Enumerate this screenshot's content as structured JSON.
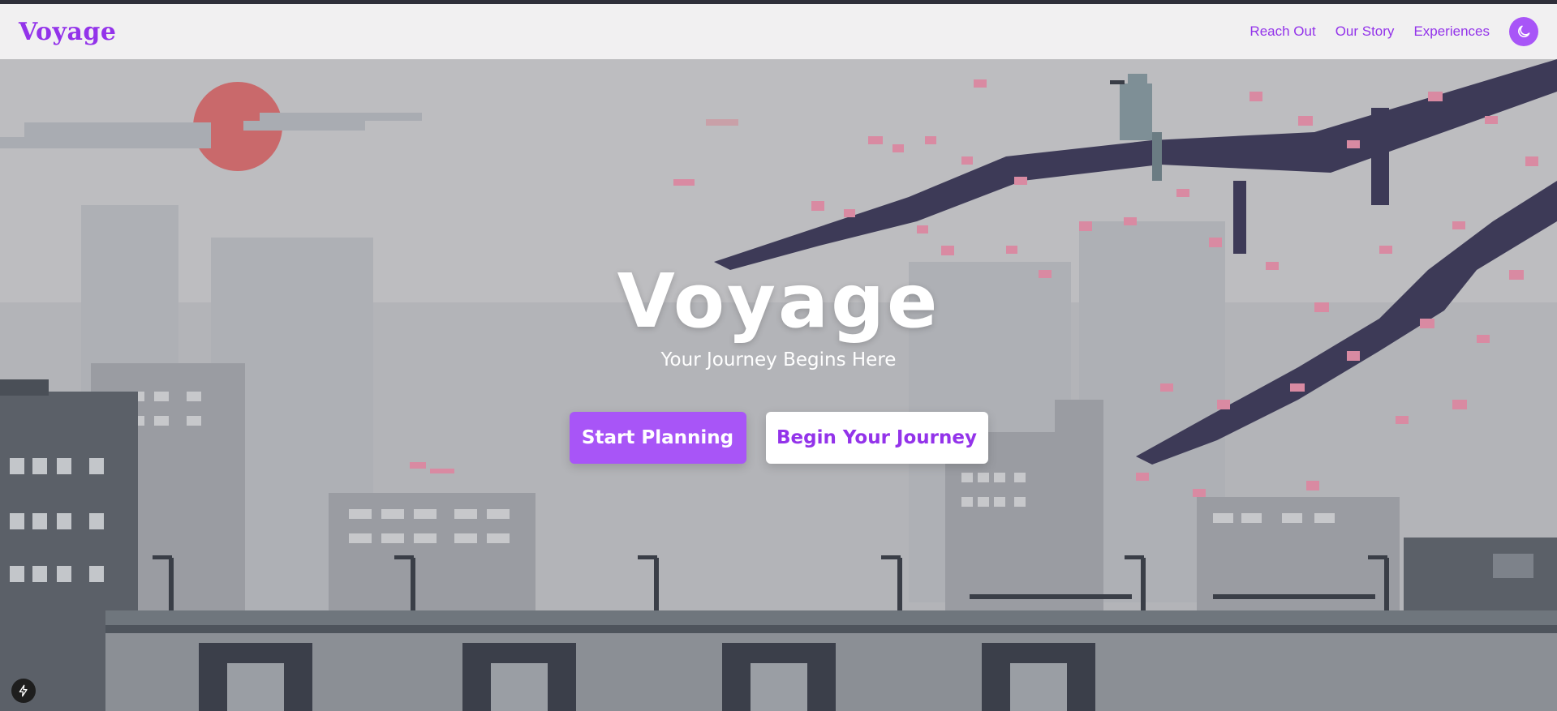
{
  "nav": {
    "brand": "Voyage",
    "links": [
      "Reach Out",
      "Our Story",
      "Experiences"
    ],
    "theme_icon": "moon-icon"
  },
  "hero": {
    "title": "Voyage",
    "subtitle": "Your Journey Begins Here",
    "primary_button": "Start Planning",
    "secondary_button": "Begin Your Journey",
    "background": "pixel-art city skyline with cherry blossom branch, bird and red sun"
  },
  "badge": {
    "icon": "lightning-bolt-icon"
  },
  "colors": {
    "accent": "#a855f7",
    "accent_text": "#9333ea",
    "nav_bg": "#f2f1f3",
    "sun": "#c9696b",
    "branch": "#3d3a57",
    "blossom": "#d98aa2"
  }
}
